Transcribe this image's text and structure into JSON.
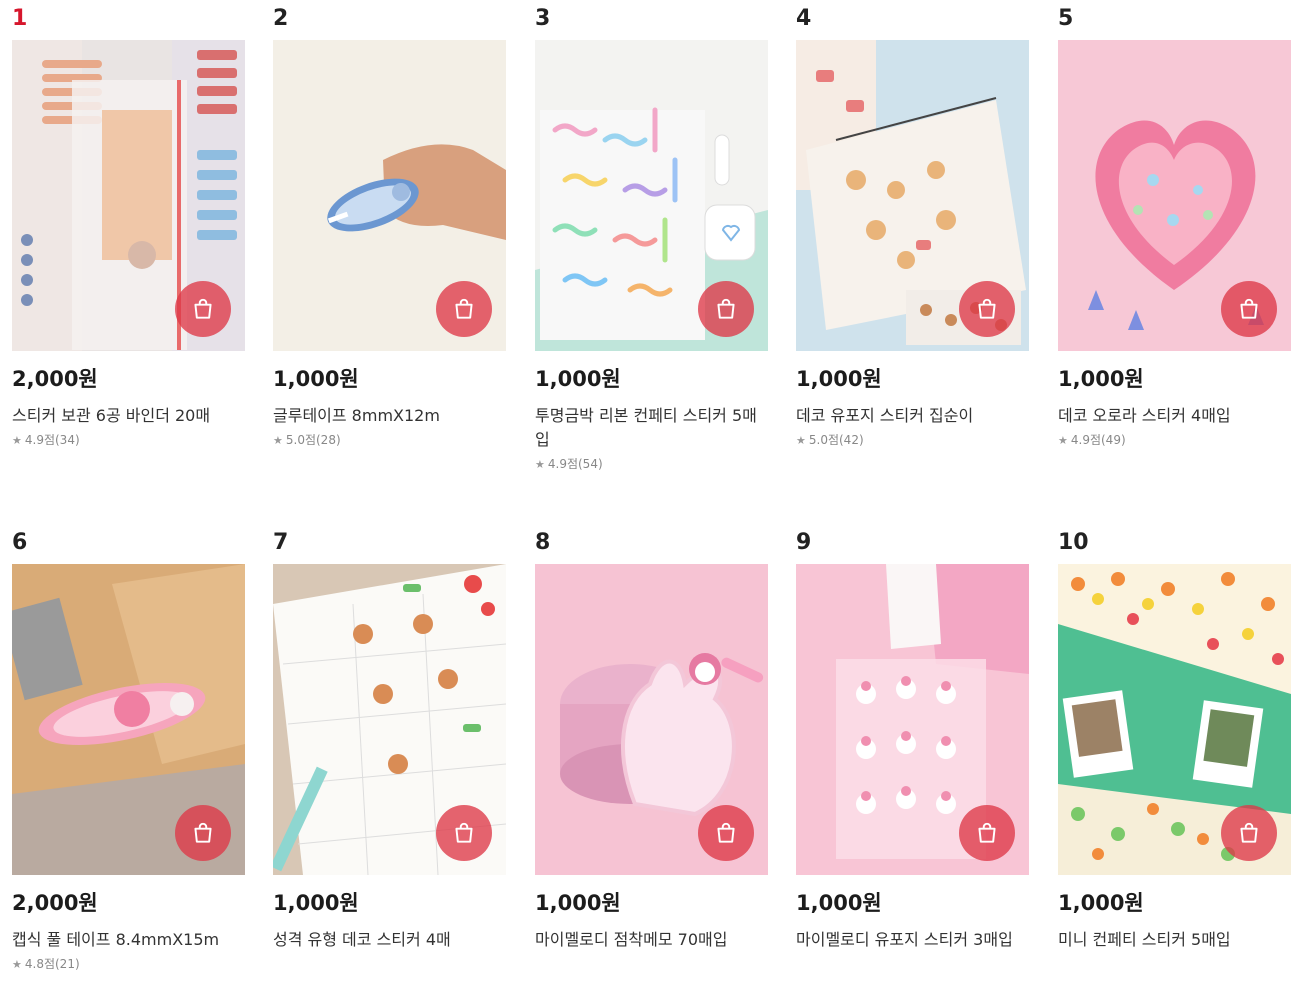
{
  "cart_icon": "shopping-bag-icon",
  "accent_color": "#d6162c",
  "products": [
    {
      "rank": "1",
      "price": "2,000원",
      "name": "스티커 보관 6공 바인더 20매",
      "rating": "4.9점",
      "reviews": "(34)"
    },
    {
      "rank": "2",
      "price": "1,000원",
      "name": "글루테이프 8mmX12m",
      "rating": "5.0점",
      "reviews": "(28)"
    },
    {
      "rank": "3",
      "price": "1,000원",
      "name": "투명금박 리본 컨페티 스티커 5매입",
      "rating": "4.9점",
      "reviews": "(54)"
    },
    {
      "rank": "4",
      "price": "1,000원",
      "name": "데코 유포지 스티커 집순이",
      "rating": "5.0점",
      "reviews": "(42)"
    },
    {
      "rank": "5",
      "price": "1,000원",
      "name": "데코 오로라 스티커 4매입",
      "rating": "4.9점",
      "reviews": "(49)"
    },
    {
      "rank": "6",
      "price": "2,000원",
      "name": "캡식 풀 테이프 8.4mmX15m",
      "rating": "4.8점",
      "reviews": "(21)"
    },
    {
      "rank": "7",
      "price": "1,000원",
      "name": "성격 유형 데코 스티커 4매"
    },
    {
      "rank": "8",
      "price": "1,000원",
      "name": "마이멜로디 점착메모 70매입"
    },
    {
      "rank": "9",
      "price": "1,000원",
      "name": "마이멜로디 유포지 스티커 3매입"
    },
    {
      "rank": "10",
      "price": "1,000원",
      "name": "미니 컨페티 스티커 5매입"
    }
  ]
}
